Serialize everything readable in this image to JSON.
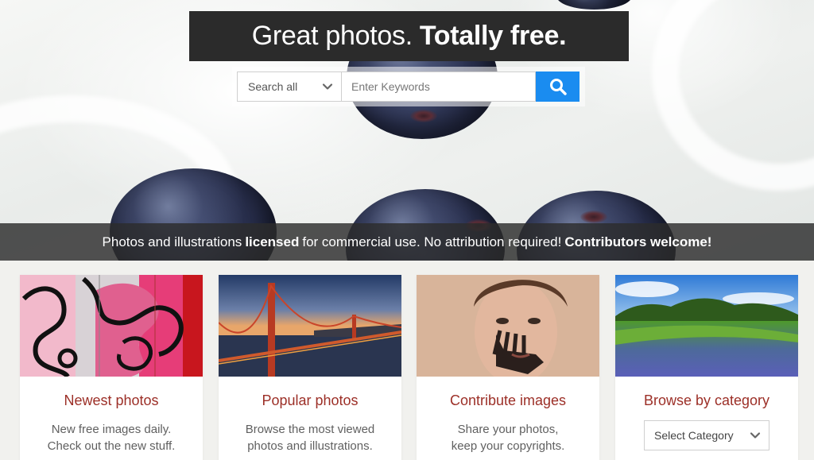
{
  "hero": {
    "title_light": "Great photos.",
    "title_bold": "Totally free."
  },
  "search": {
    "scope_selected": "Search all",
    "placeholder": "Enter Keywords",
    "button_color": "#1a8cf0"
  },
  "tagline": {
    "part1": "Photos and illustrations",
    "part2": "licensed",
    "part3": "for commercial use. No attribution required!",
    "part4": "Contributors welcome!"
  },
  "cards": [
    {
      "title": "Newest photos",
      "line1": "New free images daily.",
      "line2": "Check out the new stuff."
    },
    {
      "title": "Popular photos",
      "line1": "Browse the most viewed",
      "line2": "photos and illustrations."
    },
    {
      "title": "Contribute images",
      "line1": "Share your photos,",
      "line2": "keep your copyrights."
    },
    {
      "title": "Browse by category",
      "select_label": "Select Category"
    }
  ],
  "colors": {
    "card_title": "#9c2f27",
    "title_box": "#2b2b2b",
    "page_bg": "#f1f1ee"
  }
}
